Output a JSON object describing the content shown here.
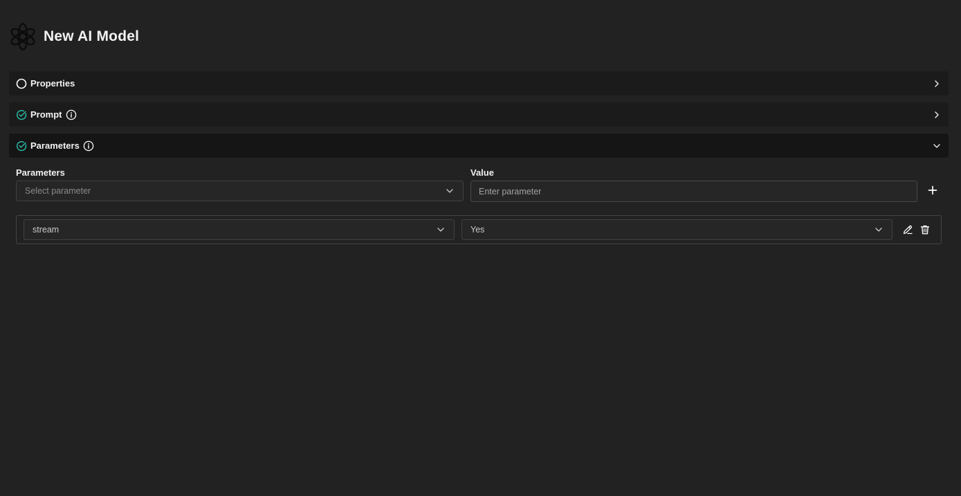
{
  "header": {
    "title": "New AI Model",
    "logo_icon": "openai-logo-icon"
  },
  "sections": [
    {
      "label": "Properties",
      "status": "incomplete",
      "status_icon": "circle-outline-icon",
      "info": false,
      "expanded": false
    },
    {
      "label": "Prompt",
      "status": "complete",
      "status_icon": "check-circle-icon",
      "info": true,
      "expanded": false
    },
    {
      "label": "Parameters",
      "status": "complete",
      "status_icon": "check-circle-icon",
      "info": true,
      "expanded": true
    }
  ],
  "parameters_panel": {
    "parameter_label": "Parameters",
    "value_label": "Value",
    "select_placeholder": "Select parameter",
    "value_placeholder": "Enter parameter",
    "rows": [
      {
        "parameter": "stream",
        "value": "Yes"
      }
    ]
  },
  "colors": {
    "background": "#222222",
    "section_bg": "#1b1b1b",
    "check_accent": "#2bb7a3",
    "border": "#424242"
  }
}
